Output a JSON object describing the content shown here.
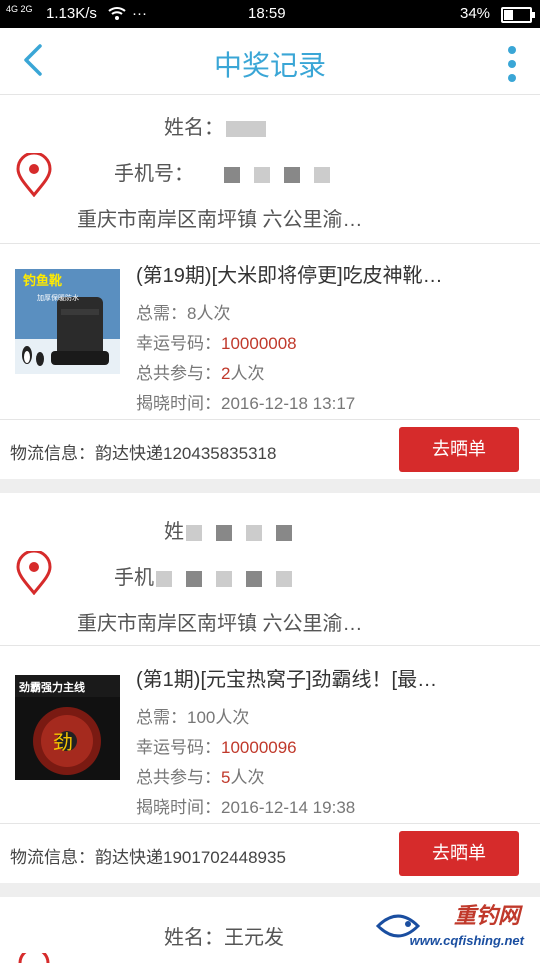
{
  "status_bar": {
    "network": "4G\n2G",
    "speed": "1.13K/s",
    "dots": "···",
    "time": "18:59",
    "battery": "34%",
    "battery_level": 0.34
  },
  "header": {
    "title": "中奖记录"
  },
  "records": [
    {
      "name": "姓名：",
      "phone": "手机号：",
      "address": "重庆市南岸区南坪镇 六公里渝…",
      "product_title": "(第19期)[大米即将停更]吃皮神靴…",
      "total_label": "总需：8人次",
      "lucky_label": "幸运号码：",
      "lucky_number": "10000008",
      "participate_label": "总共参与：",
      "participate_count": "2",
      "participate_unit": "人次",
      "reveal_time": "揭晓时间：2016-12-18 13:17",
      "logistics": "物流信息：韵达快递120435835318",
      "button": "去晒单",
      "thumb_text": "钓鱼靴",
      "thumb_sub": "加厚保暖防水"
    },
    {
      "name": "姓",
      "phone": "手机",
      "address": "重庆市南岸区南坪镇 六公里渝…",
      "product_title": "(第1期)[元宝热窝子]劲霸线！[最…",
      "total_label": "总需：100人次",
      "lucky_label": "幸运号码：",
      "lucky_number": "10000096",
      "participate_label": "总共参与：",
      "participate_count": "5",
      "participate_unit": "人次",
      "reveal_time": "揭晓时间：2016-12-14 19:38",
      "logistics": "物流信息：韵达快递1901702448935",
      "button": "去晒单",
      "thumb_text": "劲霸强力主线",
      "thumb_sub": "劲"
    },
    {
      "name": "姓名：王元发"
    }
  ],
  "watermark": {
    "brand": "重钓网",
    "url": "www.cqfishing.net"
  },
  "colors": {
    "accent": "#3aa6d6",
    "button": "#d62b2b",
    "lucky": "#c0392b"
  }
}
